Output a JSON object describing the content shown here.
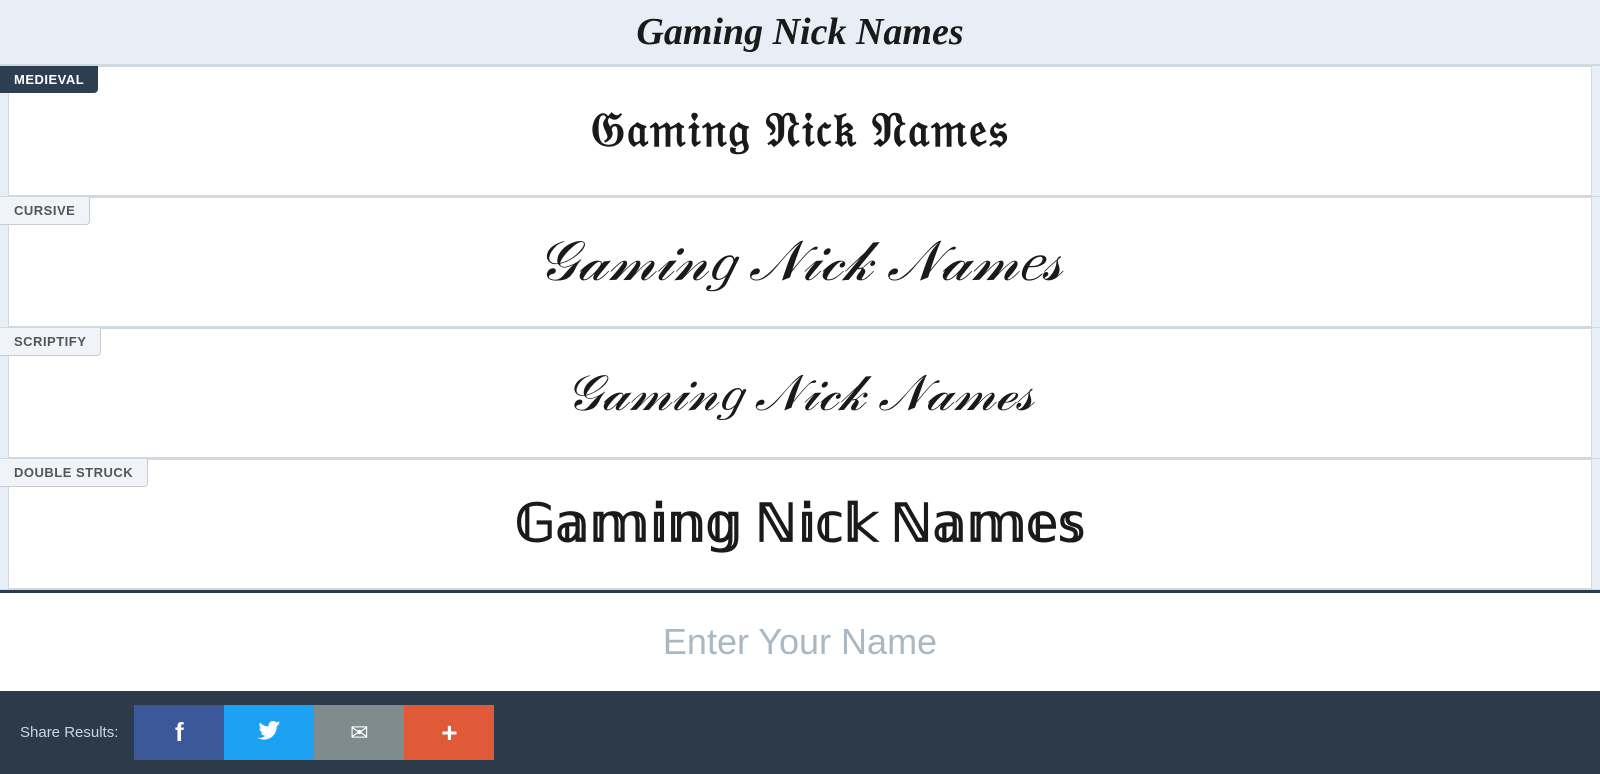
{
  "sections": [
    {
      "id": "top-preview",
      "label": null,
      "label_style": "none",
      "text": "Gaming Nick Names",
      "style": "top-preview"
    },
    {
      "id": "medieval",
      "label": "MEDIEVAL",
      "label_style": "dark",
      "text": "𝔊𝔞𝔪𝔦𝔫𝔤 𝔑𝔦𝔠𝔨 𝔑𝔞𝔪𝔢𝔰",
      "style": "medieval"
    },
    {
      "id": "cursive",
      "label": "CURSIVE",
      "label_style": "light",
      "text": "𝒢𝒶𝓂𝒾𝓃𝑔 𝒩𝒾𝒸𝓀 𝒩𝒶𝓂𝑒𝓈",
      "style": "cursive"
    },
    {
      "id": "scriptify",
      "label": "SCRIPTIFY",
      "label_style": "light",
      "text": "𝒢𝒶𝓂𝒾𝓃𝑔 𝒩𝒾𝒸𝓀 𝒩𝒶𝓂ℯ𝓈",
      "style": "scriptify"
    },
    {
      "id": "double-struck",
      "label": "DOUBLE STRUCK",
      "label_style": "light",
      "text": "𝔾𝕒𝕞𝕚𝕟𝕘 ℕ𝕚𝕔𝕜 ℕ𝕒𝕞𝕖𝕤",
      "style": "double-struck"
    }
  ],
  "input": {
    "placeholder": "Enter Your Name",
    "value": ""
  },
  "share": {
    "label": "Share Results:",
    "buttons": [
      {
        "id": "facebook",
        "icon": "f",
        "label": "Facebook",
        "color": "#3b5998"
      },
      {
        "id": "twitter",
        "icon": "🐦",
        "label": "Twitter",
        "color": "#1da1f2"
      },
      {
        "id": "email",
        "icon": "✉",
        "label": "Email",
        "color": "#7f8c8d"
      },
      {
        "id": "more",
        "icon": "+",
        "label": "More",
        "color": "#e05a3a"
      }
    ]
  },
  "colors": {
    "dark_label_bg": "#2c3e50",
    "light_label_bg": "#f0f4f8",
    "section_bg": "#e8eef5",
    "display_bg": "#ffffff",
    "footer_bg": "#2c3a4a",
    "text_main": "#1a1a2e"
  }
}
